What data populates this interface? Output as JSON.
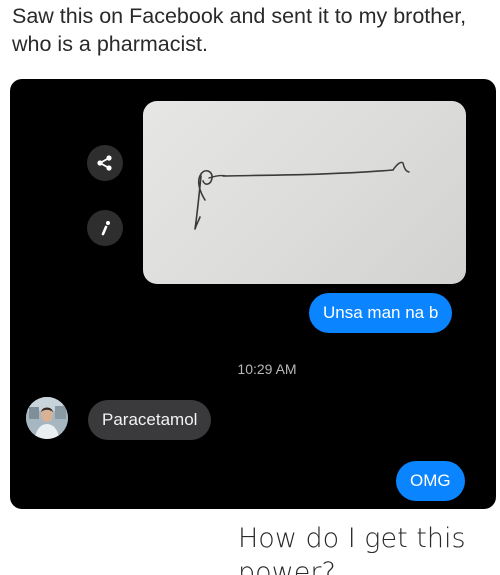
{
  "post": {
    "caption_top": "Saw this on Facebook and sent it to my brother, who is a pharmacist.",
    "caption_bottom": "How do I get this power?"
  },
  "chat": {
    "background_color": "#000000",
    "side_buttons": [
      {
        "icon": "share-icon"
      },
      {
        "icon": "pencil-icon"
      }
    ],
    "messages": [
      {
        "from": "me",
        "text": "Unsa man na b"
      },
      {
        "from": "contact",
        "text": "Paracetamol"
      },
      {
        "from": "me",
        "text": "OMG"
      }
    ],
    "timestamp": "10:29 AM",
    "colors": {
      "outgoing_bubble": "#0a84ff",
      "incoming_bubble": "#3a3a3c"
    }
  }
}
